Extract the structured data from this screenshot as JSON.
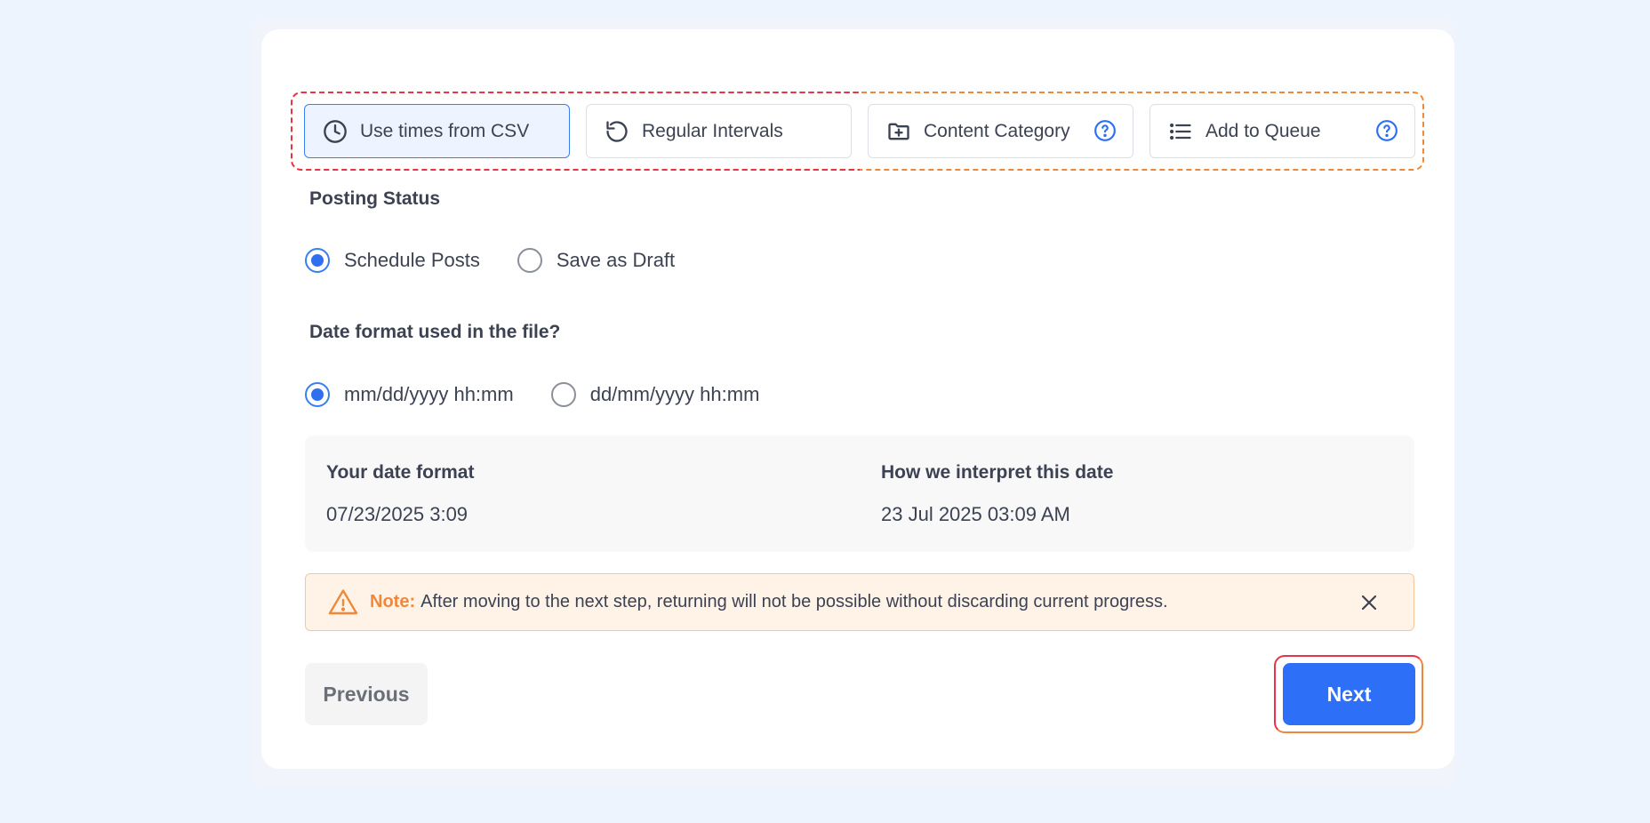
{
  "tabs": [
    {
      "label": "Use times from CSV",
      "icon": "clock-icon",
      "active": true
    },
    {
      "label": "Regular Intervals",
      "icon": "rotate-ccw-icon",
      "active": false
    },
    {
      "label": "Content Category",
      "icon": "folder-plus-icon",
      "active": false,
      "help": true
    },
    {
      "label": "Add to Queue",
      "icon": "list-icon",
      "active": false,
      "help": true
    }
  ],
  "posting_status": {
    "label": "Posting Status",
    "options": [
      "Schedule Posts",
      "Save as Draft"
    ],
    "selected": "Schedule Posts"
  },
  "date_format": {
    "label": "Date format used in the file?",
    "options": [
      "mm/dd/yyyy hh:mm",
      "dd/mm/yyyy hh:mm"
    ],
    "selected": "mm/dd/yyyy hh:mm"
  },
  "preview": {
    "your_format_label": "Your date format",
    "your_format_value": "07/23/2025 3:09",
    "interpret_label": "How we interpret this date",
    "interpret_value": "23 Jul 2025 03:09 AM"
  },
  "note": {
    "label": "Note:",
    "text": "After moving to the next step, returning will not be possible without discarding current progress."
  },
  "buttons": {
    "previous": "Previous",
    "next": "Next"
  },
  "colors": {
    "accent": "#2d6ff6",
    "warning": "#f0883a",
    "page_bg": "#eef4fd"
  }
}
